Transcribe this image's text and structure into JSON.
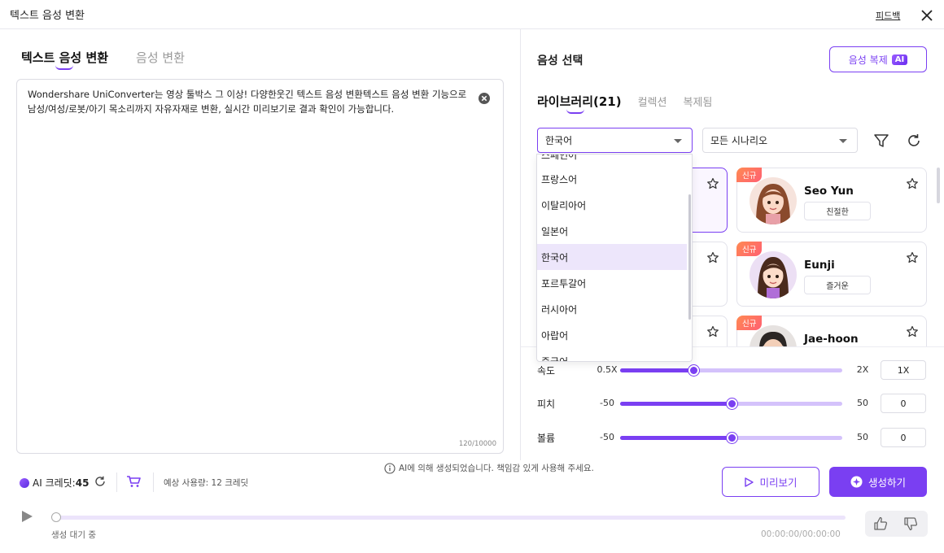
{
  "window": {
    "title": "텍스트 음성 변환",
    "feedback_label": "피드백"
  },
  "left": {
    "tabs": [
      {
        "label": "텍스트 음성 변환"
      },
      {
        "label": "음성 변환"
      }
    ],
    "editor_text": "Wondershare UniConverter는 영상 툴박스 그 이상! 다양한웃긴 텍스트 음성 변환텍스트 음성 변환 기능으로 남성/여성/로봇/아기 목소리까지 자유자재로 변환, 실시간 미리보기로 결과 확인이 가능합니다.",
    "char_count": "120/10000"
  },
  "right": {
    "title": "음성 선택",
    "clone_label": "음성 복제",
    "ai_badge": "AI",
    "library_tabs": [
      {
        "label": "라이브러리(21)"
      },
      {
        "label": "컬렉션"
      },
      {
        "label": "복제됨"
      }
    ],
    "language_select": "한국어",
    "scenario_select": "모든 시나리오",
    "language_options": [
      "스페인어",
      "프랑스어",
      "이탈리아어",
      "일본어",
      "한국어",
      "포르투갈어",
      "러시아어",
      "아랍어",
      "중국어"
    ],
    "selected_language_index": 4,
    "voices": [
      {
        "new_badge": "",
        "name": "",
        "tag": ""
      },
      {
        "new_badge": "신규",
        "name": "Seo Yun",
        "tag": "친절한"
      },
      {
        "new_badge": "",
        "name": "",
        "tag": ""
      },
      {
        "new_badge": "신규",
        "name": "Eunji",
        "tag": "즐거운"
      },
      {
        "new_badge": "",
        "name": "",
        "tag": ""
      },
      {
        "new_badge": "신규",
        "name": "Jae-hoon",
        "tag": ""
      }
    ],
    "sliders": [
      {
        "label": "속도",
        "min": "0.5X",
        "max": "2X",
        "value": "1X",
        "fraction": 0.33
      },
      {
        "label": "피치",
        "min": "-50",
        "max": "50",
        "value": "0",
        "fraction": 0.5
      },
      {
        "label": "볼륨",
        "min": "-50",
        "max": "50",
        "value": "0",
        "fraction": 0.5
      }
    ]
  },
  "footer": {
    "disclaimer": "AI에 의해 생성되었습니다. 책임감 있게 사용해 주세요.",
    "credits_label": "AI 크레딧:",
    "credits_value": "45",
    "usage": "예상 사용량: 12 크레딧",
    "preview_label": "미리보기",
    "generate_label": "생성하기",
    "status": "생성 대기 중",
    "time": "00:00:00/00:00:00",
    "progress_fraction": 0
  },
  "colors": {
    "accent": "#7a3ff2",
    "new_badge": "#ff6f60",
    "selected_option": "#ede6fb"
  }
}
